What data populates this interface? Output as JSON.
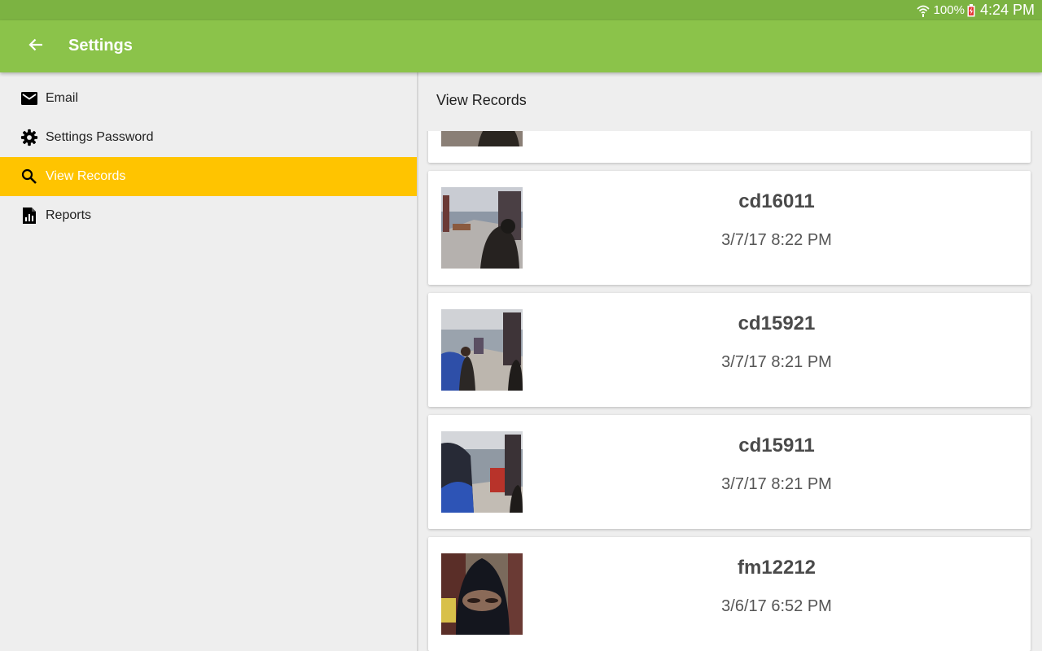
{
  "status_bar": {
    "battery": "100%",
    "time": "4:24 PM",
    "icons": [
      "wifi-icon",
      "battery-charging-icon"
    ]
  },
  "app_bar": {
    "title": "Settings",
    "back_icon": "arrow-back-icon",
    "color": "#8bc34a"
  },
  "sidebar": {
    "items": [
      {
        "label": "Email",
        "icon": "email-icon"
      },
      {
        "label": "Settings Password",
        "icon": "gear-icon"
      },
      {
        "label": "View Records",
        "icon": "search-icon",
        "selected": true
      },
      {
        "label": "Reports",
        "icon": "report-icon"
      }
    ],
    "selected_color": "#ffc400"
  },
  "main": {
    "title": "View Records",
    "records": [
      {
        "id": "",
        "timestamp": ""
      },
      {
        "id": "cd16011",
        "timestamp": "3/7/17 8:22 PM"
      },
      {
        "id": "cd15921",
        "timestamp": "3/7/17 8:21 PM"
      },
      {
        "id": "cd15911",
        "timestamp": "3/7/17 8:21 PM"
      },
      {
        "id": "fm12212",
        "timestamp": "3/6/17 6:52 PM"
      }
    ]
  }
}
